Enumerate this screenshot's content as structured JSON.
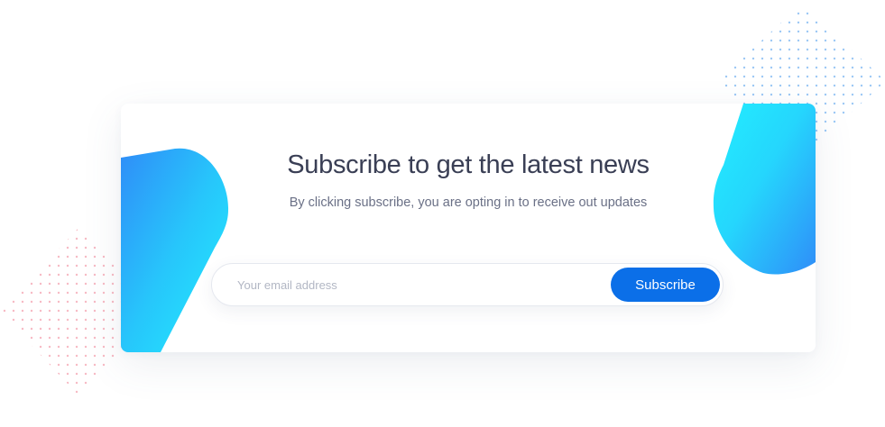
{
  "newsletter": {
    "title": "Subscribe to get the latest news",
    "subtitle": "By clicking subscribe, you are opting in to receive out updates",
    "email_placeholder": "Your email address",
    "email_value": "",
    "submit_label": "Subscribe"
  },
  "colors": {
    "accent_button": "#0b6fe8",
    "blob_gradient_light": "#22eefe",
    "blob_gradient_deep": "#2f8df8",
    "dots_blue": "#9cc8f5",
    "dots_pink": "#f7b9c3",
    "title_text": "#3a3f55",
    "subtitle_text": "#6a7086",
    "placeholder_text": "#b2b7c4"
  }
}
